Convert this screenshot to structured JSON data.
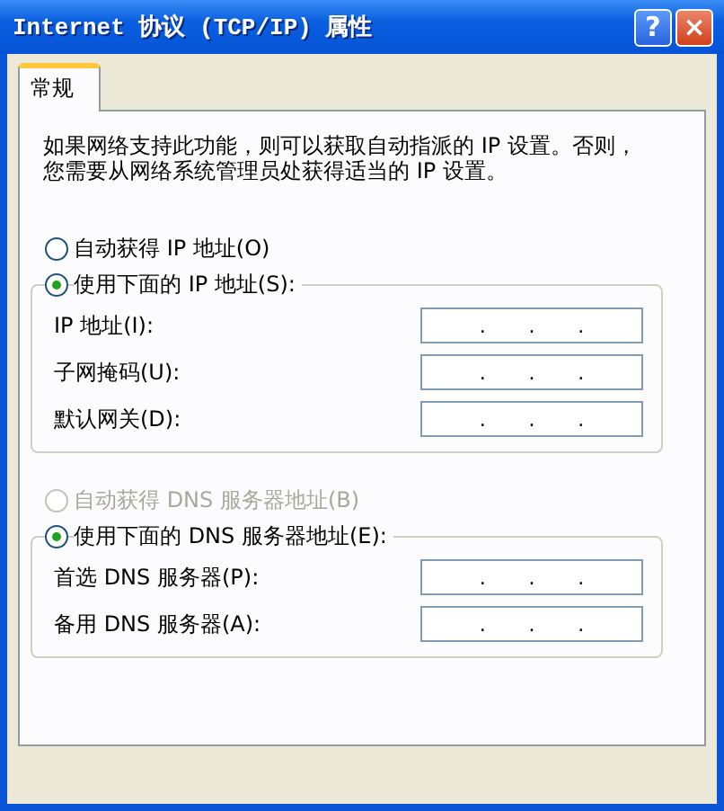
{
  "window": {
    "title": "Internet 协议 (TCP/IP) 属性",
    "buttons": [
      {
        "kind": "help",
        "label": "?"
      },
      {
        "kind": "close",
        "label": "×"
      }
    ]
  },
  "tabs": [
    {
      "label": "常规",
      "selected": true
    }
  ],
  "description_lines": [
    "如果网络支持此功能，则可以获取自动指派的 IP 设置。否则，",
    "您需要从网络系统管理员处获得适当的 IP 设置。"
  ],
  "sections": [
    {
      "auto_option": {
        "label": "自动获得 IP 地址(O)",
        "selected": false,
        "disabled": false
      },
      "manual_option": {
        "label": "使用下面的 IP 地址(S):",
        "selected": true
      },
      "fields": [
        {
          "label": "IP 地址(I):",
          "separators": [
            ".",
            ".",
            "."
          ]
        },
        {
          "label": "子网掩码(U):",
          "separators": [
            ".",
            ".",
            "."
          ]
        },
        {
          "label": "默认网关(D):",
          "separators": [
            ".",
            ".",
            "."
          ]
        }
      ]
    },
    {
      "auto_option": {
        "label": "自动获得 DNS 服务器地址(B)",
        "selected": false,
        "disabled": true
      },
      "manual_option": {
        "label": "使用下面的 DNS 服务器地址(E):",
        "selected": true
      },
      "fields": [
        {
          "label": "首选 DNS 服务器(P):",
          "separators": [
            ".",
            ".",
            "."
          ]
        },
        {
          "label": "备用 DNS 服务器(A):",
          "separators": [
            ".",
            ".",
            "."
          ]
        }
      ]
    }
  ]
}
